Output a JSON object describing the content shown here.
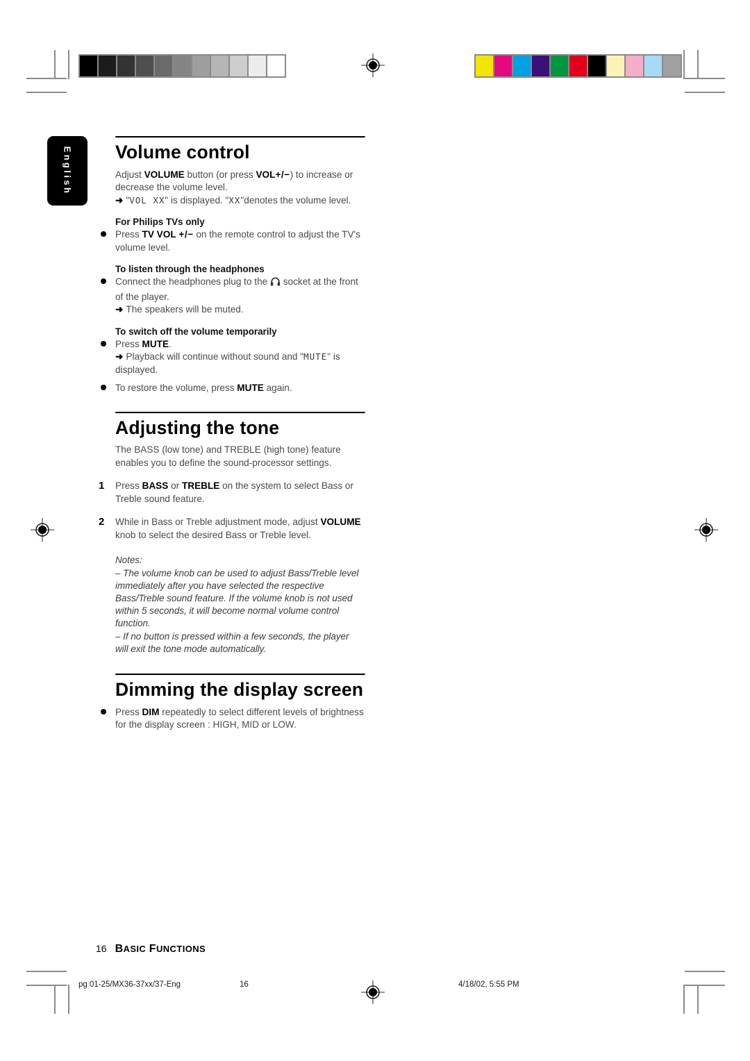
{
  "page": {
    "language_tab": "English",
    "page_number_footer": "16",
    "footer_section_title": "Basic Functions"
  },
  "print_marks": {
    "grayscale_swatches": [
      "#000000",
      "#1c1c1c",
      "#333333",
      "#4f4f4f",
      "#6b6b6b",
      "#848484",
      "#9e9e9e",
      "#b5b5b5",
      "#cecece",
      "#ececec",
      "#ffffff"
    ],
    "color_swatches": [
      "#f2e500",
      "#e5097f",
      "#00a0e3",
      "#3b1178",
      "#009640",
      "#e2001a",
      "#000000",
      "#fbf3b6",
      "#f5aec8",
      "#a6daf5",
      "#a0a0a0"
    ],
    "registration_icon": "registration-target-icon",
    "crop_mark_icon": "crop-mark"
  },
  "sections": [
    {
      "id": "volume-control",
      "heading": "Volume control",
      "intro": {
        "prefix": "Adjust ",
        "bold1": "VOLUME",
        "mid": " button (or press ",
        "bold2": "VOL",
        "plusminus": "+/−",
        "suffix": ") to increase or decrease the volume level."
      },
      "arrow_note": {
        "arrow": "➜",
        "quote_open": "\"",
        "lcd1": "VOL XX",
        "mid": "\" is displayed. \"",
        "lcd2": "XX",
        "suffix": "\"denotes the volume level."
      },
      "subsections": [
        {
          "title": "For Philips TVs only",
          "bullets": [
            {
              "prefix": "Press ",
              "bold": "TV VOL",
              "plusminus": "+/−",
              "suffix": " on the remote control to adjust the TV's volume level."
            }
          ]
        },
        {
          "title": "To listen through the headphones",
          "bullets": [
            {
              "prefix": "Connect the headphones plug to the ",
              "icon": "headphones-icon",
              "suffix": " socket at the front of the player.",
              "arrow": "➜",
              "arrow_text": "The speakers will be muted."
            }
          ]
        },
        {
          "title": "To switch off the volume temporarily",
          "bullets": [
            {
              "prefix": "Press ",
              "bold": "MUTE",
              "suffix": ".",
              "arrow": "➜",
              "arrow_prefix": "Playback will continue without sound and \"",
              "lcd": "MUTE",
              "arrow_suffix": "\" is displayed."
            },
            {
              "prefix": "To restore the volume, press ",
              "bold": "MUTE",
              "suffix": " again."
            }
          ]
        }
      ]
    },
    {
      "id": "adjusting-the-tone",
      "heading": "Adjusting the tone",
      "intro_plain": "The BASS (low tone) and TREBLE (high tone) feature enables you to define the sound-processor settings.",
      "steps": [
        {
          "number": "1",
          "prefix": "Press ",
          "bold1": "BASS",
          "mid": " or ",
          "bold2": "TREBLE",
          "suffix": " on the system to select Bass or Treble sound feature."
        },
        {
          "number": "2",
          "prefix": "While in Bass or Treble adjustment mode, adjust ",
          "bold1": "VOLUME",
          "suffix": " knob to select the desired Bass or Treble level."
        }
      ],
      "notes": {
        "label": "Notes:",
        "items": [
          "– The volume knob can be used to adjust Bass/Treble level immediately after you have selected the respective Bass/Treble sound feature.  If the volume knob is not used within 5 seconds, it will become normal volume control function.",
          "– If no button is pressed within a few seconds, the player will exit the tone mode automatically."
        ]
      }
    },
    {
      "id": "dimming-the-display-screen",
      "heading": "Dimming the display screen",
      "bullets": [
        {
          "prefix": "Press ",
          "bold": "DIM",
          "suffix": " repeatedly to select different levels of brightness for the display screen : HIGH, MID or LOW."
        }
      ]
    }
  ],
  "print_info": {
    "filename": "pg 01-25/MX36-37xx/37-Eng",
    "page": "16",
    "timestamp": "4/18/02, 5:55 PM"
  }
}
